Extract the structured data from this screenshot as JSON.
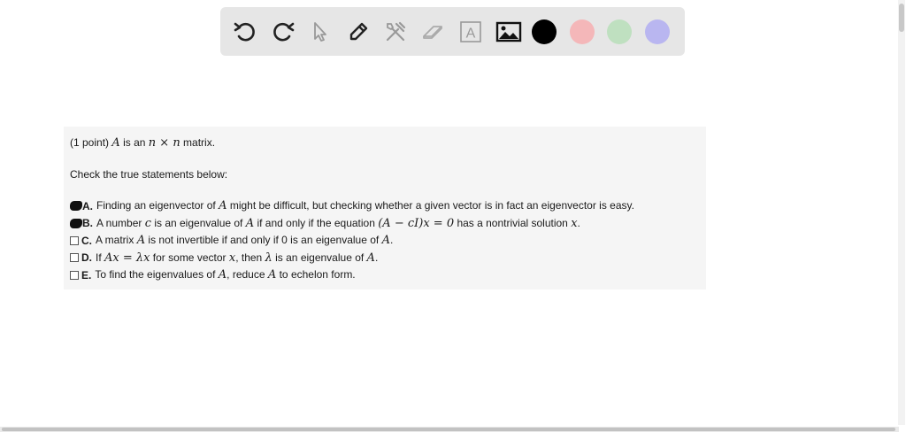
{
  "toolbar": {
    "tools": [
      {
        "icon": "undo-icon"
      },
      {
        "icon": "redo-icon"
      },
      {
        "icon": "pointer-icon"
      },
      {
        "icon": "pen-icon"
      },
      {
        "icon": "tools-icon"
      },
      {
        "icon": "eraser-icon"
      },
      {
        "icon": "text-icon",
        "glyph": "A"
      },
      {
        "icon": "image-icon"
      }
    ],
    "colors": [
      "#000000",
      "#f4b7b9",
      "#bfe0c0",
      "#b9b6f0"
    ]
  },
  "problem": {
    "intro_prefix": "(1 point) ",
    "intro_var": "A",
    "intro_mid": " is an ",
    "intro_n1": "n",
    "intro_times": " × ",
    "intro_n2": "n",
    "intro_suffix": " matrix.",
    "instruction": "Check the true statements below:",
    "options": {
      "a": {
        "letter": "A.",
        "t1": " Finding an eigenvector of ",
        "v1": "A",
        "t2": " might be difficult, but checking whether a given vector is in fact an eigenvector is easy."
      },
      "b": {
        "letter": "B.",
        "t1": " A number ",
        "v1": "c",
        "t2": " is an eigenvalue of ",
        "v2": "A",
        "t3": " if and only if the equation ",
        "eq": "(A − cI)x = 0",
        "t4": " has a nontrivial solution ",
        "v3": "x",
        "t5": "."
      },
      "c": {
        "letter": "C.",
        "t1": " A matrix ",
        "v1": "A",
        "t2": " is not invertible if and only if 0 is an eigenvalue of ",
        "v2": "A",
        "t3": "."
      },
      "d": {
        "letter": "D.",
        "t1": " If ",
        "eq": "Ax = λx",
        "t2": " for some vector ",
        "v1": "x",
        "t3": ", then ",
        "v2": "λ",
        "t4": " is an eigenvalue of ",
        "v3": "A",
        "t5": "."
      },
      "e": {
        "letter": "E.",
        "t1": " To find the eigenvalues of ",
        "v1": "A",
        "t2": ", reduce ",
        "v2": "A",
        "t3": " to echelon form."
      }
    }
  }
}
